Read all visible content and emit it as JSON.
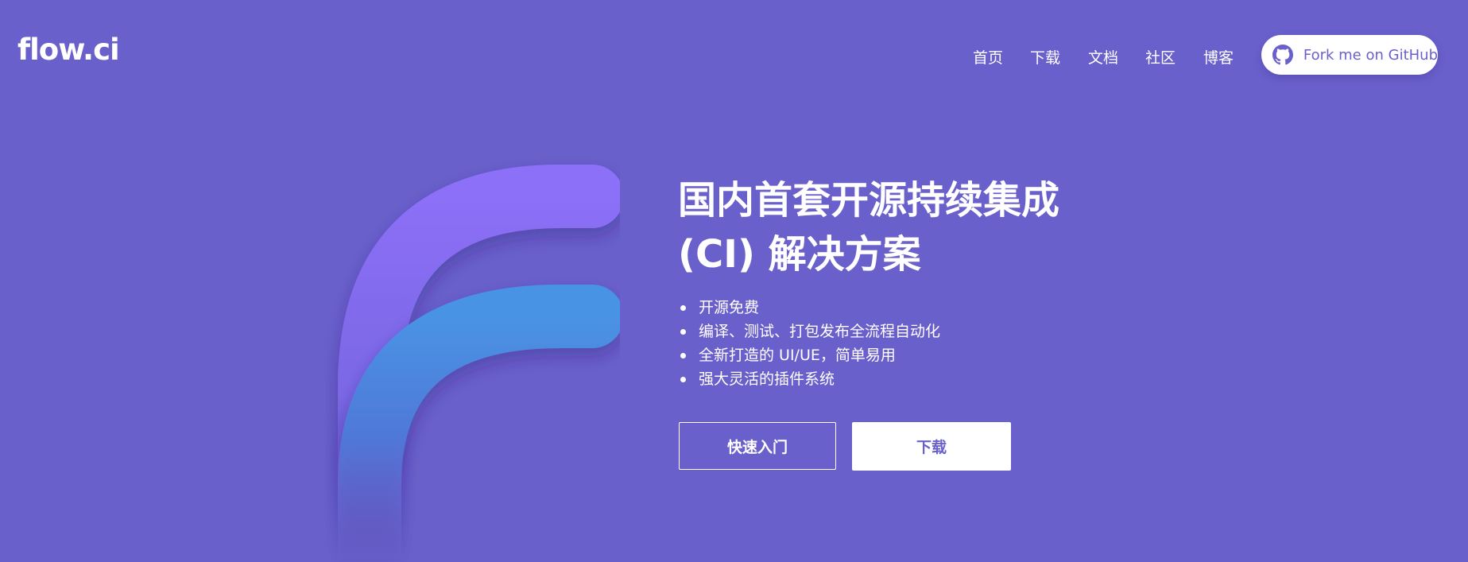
{
  "header": {
    "logo": "flow.ci",
    "nav": [
      {
        "label": "首页"
      },
      {
        "label": "下载"
      },
      {
        "label": "文档"
      },
      {
        "label": "社区"
      },
      {
        "label": "博客"
      }
    ],
    "github_button": {
      "label": "Fork me on GitHub",
      "icon": "github-icon"
    }
  },
  "hero": {
    "title_line1": "国内首套开源持续集成",
    "title_line2": "(CI) 解决方案",
    "features": [
      "开源免费",
      "编译、测试、打包发布全流程自动化",
      "全新打造的 UI/UE，简单易用",
      "强大灵活的插件系统"
    ],
    "primary_button": "快速入门",
    "secondary_button": "下载",
    "graphic": "flow-ci-f-logo"
  },
  "colors": {
    "background": "#6a60cb",
    "logo_purple_top": "#8c6ff7",
    "logo_blue": "#4a90e2",
    "text": "#ffffff",
    "accent": "#6a60cb"
  }
}
